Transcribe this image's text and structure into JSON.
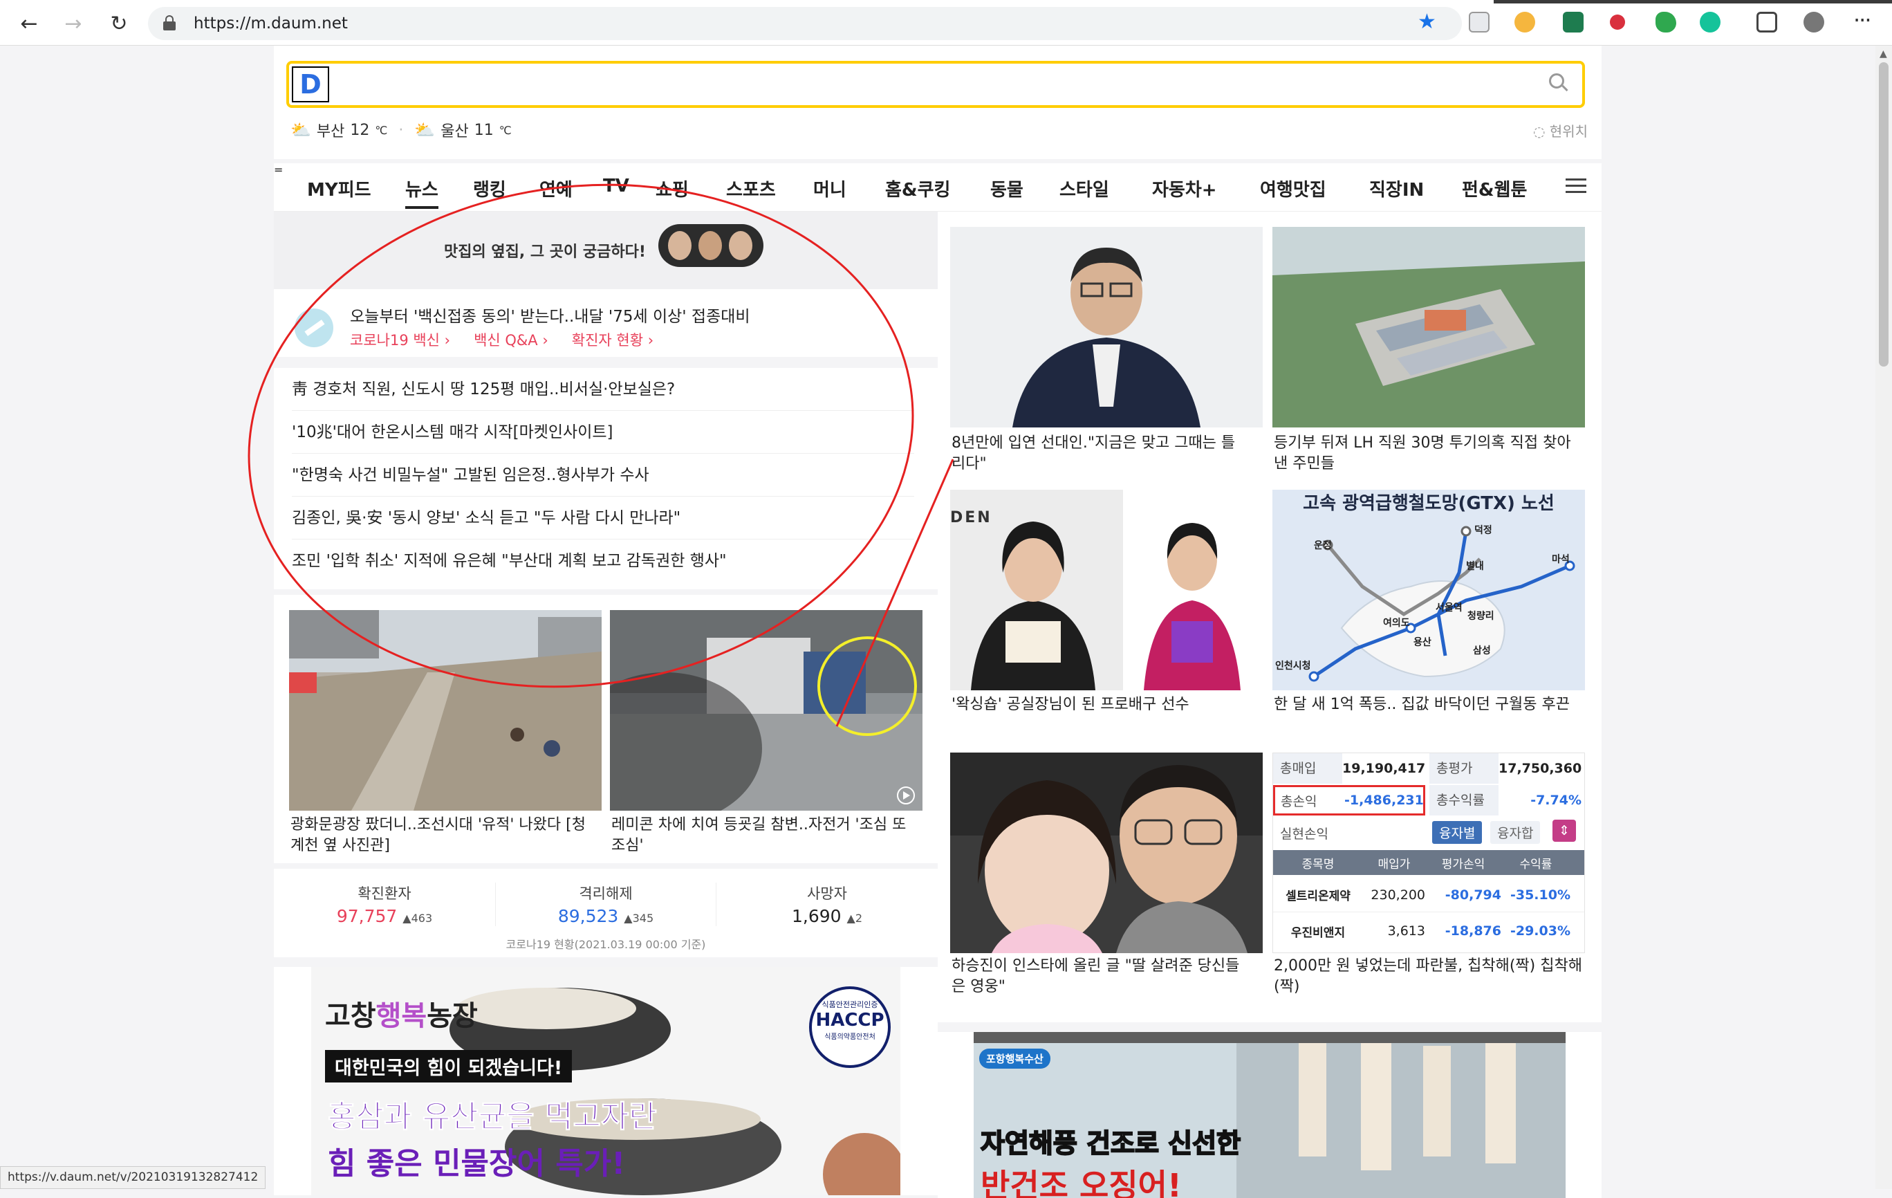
{
  "browser": {
    "url": "https://m.daum.net",
    "status_url": "https://v.daum.net/v/20210319132827412"
  },
  "search": {
    "logo": "D"
  },
  "weather": {
    "items": [
      {
        "city": "부산",
        "temp": "12",
        "unit": "℃"
      },
      {
        "city": "울산",
        "temp": "11",
        "unit": "℃"
      }
    ],
    "locate": "현위치"
  },
  "tabs": [
    "MY피드",
    "뉴스",
    "랭킹",
    "연예",
    "TV",
    "쇼핑",
    "스포츠",
    "머니",
    "홈&쿠킹",
    "동물",
    "스타일",
    "자동차+",
    "여행맛집",
    "직장IN",
    "펀&웹툰"
  ],
  "promo": {
    "text": "맛집의 옆집, 그 곳이 궁금하다!"
  },
  "covid_banner": {
    "headline": "오늘부터 '백신접종 동의' 받는다..내달 '75세 이상' 접종대비",
    "links": [
      "코로나19 백신",
      "백신 Q&A",
      "확진자 현황"
    ]
  },
  "news": [
    "靑 경호처 직원, 신도시 땅 125평 매입..비서실·안보실은?",
    "'10兆'대어 한온시스템 매각 시작[마켓인사이트]",
    "\"한명숙 사건 비밀누설\" 고발된 임은정..형사부가 수사",
    "김종인, 吳·安 '동시 양보' 소식 듣고 \"두 사람 다시 만나라\"",
    "조민 '입학 취소' 지적에 유은혜 \"부산대 계획 보고 감독권한 행사\""
  ],
  "photo_news": [
    {
      "line1": "광화문광장 팠더니..조선시대 '유적' 나왔다 [청",
      "line2": "계천 옆 사진관]"
    },
    {
      "line1": "레미콘 차에 치여 등굣길 참변..자전거 '조심 또",
      "line2": "조심'"
    }
  ],
  "covid_stats": {
    "items": [
      {
        "label": "확진환자",
        "value": "97,757",
        "inc": "463",
        "color": "#e8415a"
      },
      {
        "label": "격리해제",
        "value": "89,523",
        "inc": "345",
        "color": "#2b6de0"
      },
      {
        "label": "사망자",
        "value": "1,690",
        "inc": "2",
        "color": "#222222"
      }
    ],
    "note": "코로나19 현황(2021.03.19 00:00 기준)"
  },
  "ad_left": {
    "brand_a": "고창",
    "brand_b": "행복",
    "brand_c": "농장",
    "banner": "대한민국의 힘이 되겠습니다!",
    "line1": "홍삼과 유산균을 먹고자란",
    "line2": "힘 좋은 민물장어 특가!",
    "seal_top": "식품안전관리인증",
    "seal": "HACCP",
    "seal_bottom": "식품의약품안전처"
  },
  "right_cards": [
    {
      "line1": "8년만에 입연 선대인.\"지금은 맞고 그때는 틀",
      "line2": "리다\""
    },
    {
      "line1": "등기부 뒤져 LH 직원 30명 투기의혹 직접 찾아",
      "line2": "낸 주민들"
    },
    {
      "line1": "'왁싱숍' 공실장님이 된 프로배구 선수",
      "line2": ""
    },
    {
      "line1": "한 달 새 1억 폭등.. 집값 바닥이던 구월동 후끈",
      "line2": ""
    },
    {
      "line1": "하승진이 인스타에 올린 글 \"딸 살려준 당신들",
      "line2": "은 영웅\""
    },
    {
      "line1": "2,000만 원 넣었는데 파란불, 칩착해(짝) 칩착해",
      "line2": "(짝)"
    }
  ],
  "gtx": {
    "title": "고속 광역급행철도망(GTX) 노선",
    "stations": [
      "운정",
      "덕정",
      "별내",
      "마석",
      "서울역",
      "여의도",
      "청량리",
      "용산",
      "삼성",
      "인천시청"
    ]
  },
  "den_sign": "DEN",
  "stock": {
    "rows": [
      {
        "k1": "총매입",
        "v1": "19,190,417",
        "k2": "총평가",
        "v2": "17,750,360"
      },
      {
        "k1": "총손익",
        "v1": "-1,486,231",
        "k2": "총수익률",
        "v2": "-7.74%"
      }
    ],
    "realized": "실현손익",
    "btn_a": "융자별",
    "btn_b": "융자합",
    "headers": [
      "종목명",
      "매입가",
      "평가손익",
      "수익률"
    ],
    "items": [
      {
        "name": "셀트리온제약",
        "buy": "230,200",
        "pl": "-80,794",
        "rate": "-35.10%"
      },
      {
        "name": "우진비앤지",
        "buy": "3,613",
        "pl": "-18,876",
        "rate": "-29.03%"
      }
    ]
  },
  "ad_right": {
    "brand": "포항행복수산",
    "line1": "자연해풍 건조로 신선한",
    "line2": "반건조 오징어!"
  }
}
